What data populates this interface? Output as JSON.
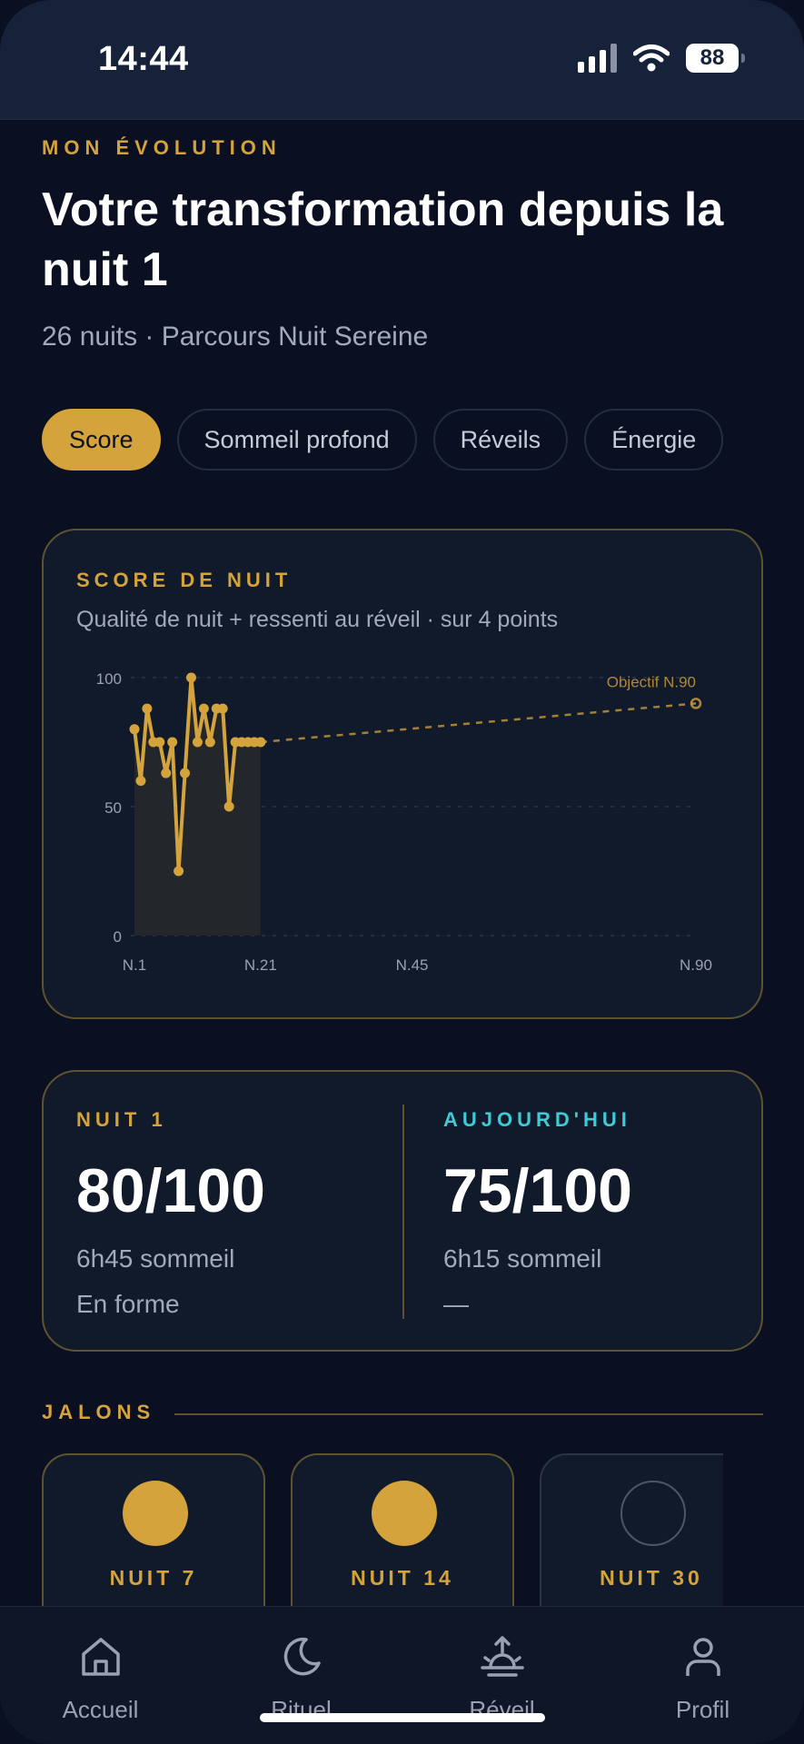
{
  "status_bar": {
    "time": "14:44",
    "battery": "88"
  },
  "header": {
    "eyebrow": "MON ÉVOLUTION",
    "title": "Votre transformation depuis la nuit 1",
    "subtitle": "26 nuits · Parcours Nuit Sereine"
  },
  "tabs": [
    {
      "label": "Score",
      "active": true
    },
    {
      "label": "Sommeil profond",
      "active": false
    },
    {
      "label": "Réveils",
      "active": false
    },
    {
      "label": "Énergie",
      "active": false
    }
  ],
  "score_card": {
    "eyebrow": "SCORE DE NUIT",
    "subtitle": "Qualité de nuit + ressenti au réveil · sur 4 points"
  },
  "chart_data": {
    "type": "line",
    "title": "SCORE DE NUIT",
    "ylim": [
      0,
      100
    ],
    "yticks": [
      0,
      50,
      100
    ],
    "xlim": [
      1,
      90
    ],
    "xticks": [
      {
        "value": 1,
        "label": "N.1"
      },
      {
        "value": 21,
        "label": "N.21"
      },
      {
        "value": 45,
        "label": "N.45"
      },
      {
        "value": 90,
        "label": "N.90"
      }
    ],
    "grid": true,
    "series": [
      {
        "x": [
          1,
          2,
          3,
          4,
          5,
          6,
          7,
          8,
          9,
          10,
          11,
          12,
          13,
          14,
          15,
          16,
          17,
          18,
          19,
          20,
          21
        ],
        "values": [
          80,
          60,
          88,
          75,
          75,
          63,
          75,
          25,
          63,
          100,
          75,
          88,
          75,
          88,
          88,
          50,
          75,
          75,
          75,
          75,
          75
        ]
      }
    ],
    "target": {
      "label": "Objectif N.90",
      "from_x": 21,
      "from_y": 75,
      "x": 90,
      "y": 90
    },
    "colors": {
      "line": "#d4a33b",
      "area": "#25272a",
      "grid": "#2a3347",
      "tick": "#9aa1b0"
    }
  },
  "comparison": {
    "left": {
      "eyebrow": "NUIT 1",
      "value": "80/100",
      "sleep": "6h45 sommeil",
      "feeling": "En forme"
    },
    "right": {
      "eyebrow": "AUJOURD'HUI",
      "value": "75/100",
      "sleep": "6h15 sommeil",
      "feeling": "—"
    }
  },
  "milestones_section": {
    "label": "JALONS",
    "items": [
      {
        "label": "NUIT 7",
        "reached": true
      },
      {
        "label": "NUIT 14",
        "reached": true
      },
      {
        "label": "NUIT 30",
        "reached": false
      }
    ]
  },
  "bottom_nav": {
    "items": [
      {
        "label": "Accueil",
        "icon": "home-icon"
      },
      {
        "label": "Rituel",
        "icon": "moon-icon"
      },
      {
        "label": "Réveil",
        "icon": "sunrise-icon"
      },
      {
        "label": "Profil",
        "icon": "profile-icon"
      }
    ]
  },
  "colors": {
    "accent": "#d4a33b",
    "teal": "#3ecbd6",
    "background": "#0a1022",
    "card": "#111a2b"
  }
}
